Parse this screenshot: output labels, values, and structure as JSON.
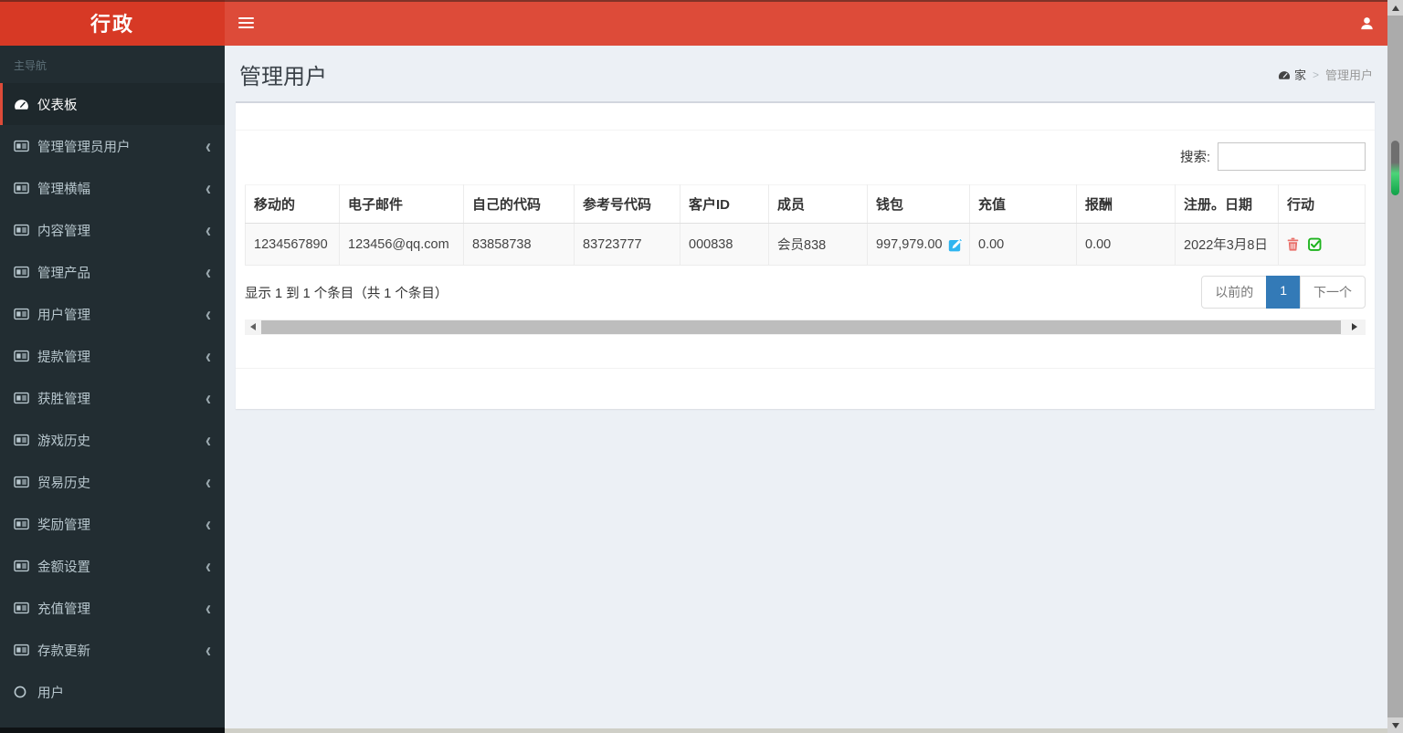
{
  "topbar": {
    "brand": "行政"
  },
  "sidebar": {
    "header": "主导航",
    "chevron_glyph": "‹",
    "items": [
      {
        "label": "仪表板",
        "icon": "tachometer-icon",
        "active": true,
        "chevron": false
      },
      {
        "label": "管理管理员用户",
        "icon": "newspaper-icon",
        "active": false,
        "chevron": true
      },
      {
        "label": "管理横幅",
        "icon": "newspaper-icon",
        "active": false,
        "chevron": true
      },
      {
        "label": "内容管理",
        "icon": "newspaper-icon",
        "active": false,
        "chevron": true
      },
      {
        "label": "管理产品",
        "icon": "newspaper-icon",
        "active": false,
        "chevron": true
      },
      {
        "label": "用户管理",
        "icon": "newspaper-icon",
        "active": false,
        "chevron": true
      },
      {
        "label": "提款管理",
        "icon": "newspaper-icon",
        "active": false,
        "chevron": true
      },
      {
        "label": "获胜管理",
        "icon": "newspaper-icon",
        "active": false,
        "chevron": true
      },
      {
        "label": "游戏历史",
        "icon": "newspaper-icon",
        "active": false,
        "chevron": true
      },
      {
        "label": "贸易历史",
        "icon": "newspaper-icon",
        "active": false,
        "chevron": true
      },
      {
        "label": "奖励管理",
        "icon": "newspaper-icon",
        "active": false,
        "chevron": true
      },
      {
        "label": "金额设置",
        "icon": "newspaper-icon",
        "active": false,
        "chevron": true
      },
      {
        "label": "充值管理",
        "icon": "newspaper-icon",
        "active": false,
        "chevron": true
      },
      {
        "label": "存款更新",
        "icon": "newspaper-icon",
        "active": false,
        "chevron": true
      },
      {
        "label": "用户",
        "icon": "circle-icon",
        "active": false,
        "chevron": false
      }
    ]
  },
  "page": {
    "title": "管理用户",
    "breadcrumb": {
      "home": "家",
      "separator": ">",
      "current": "管理用户"
    }
  },
  "search": {
    "label": "搜索:",
    "value": "",
    "placeholder": ""
  },
  "table": {
    "columns": [
      "移动的",
      "电子邮件",
      "自己的代码",
      "参考号代码",
      "客户ID",
      "成员",
      "钱包",
      "充值",
      "报酬",
      "注册。日期",
      "行动"
    ],
    "rows": [
      {
        "mobile": "1234567890",
        "email": "123456@qq.com",
        "own_code": "83858738",
        "ref_code": "83723777",
        "customer_id": "000838",
        "member": "会员838",
        "wallet": "997,979.00",
        "recharge": "0.00",
        "reward": "0.00",
        "reg_date": "2022年3月8日"
      }
    ]
  },
  "pagination": {
    "info": "显示 1 到 1 个条目（共 1 个条目）",
    "previous": "以前的",
    "current_page": "1",
    "next": "下一个"
  },
  "colors": {
    "navbar_red": "#dd4b39",
    "logo_red": "#d73925",
    "sidebar_bg": "#222d32",
    "sidebar_active_bg": "#1e282c",
    "content_bg": "#ecf0f5",
    "active_page_blue": "#337ab7",
    "edit_icon_blue": "#2fb5f0",
    "trash_icon_red": "#e9706a",
    "check_icon_green": "#1db31d"
  }
}
